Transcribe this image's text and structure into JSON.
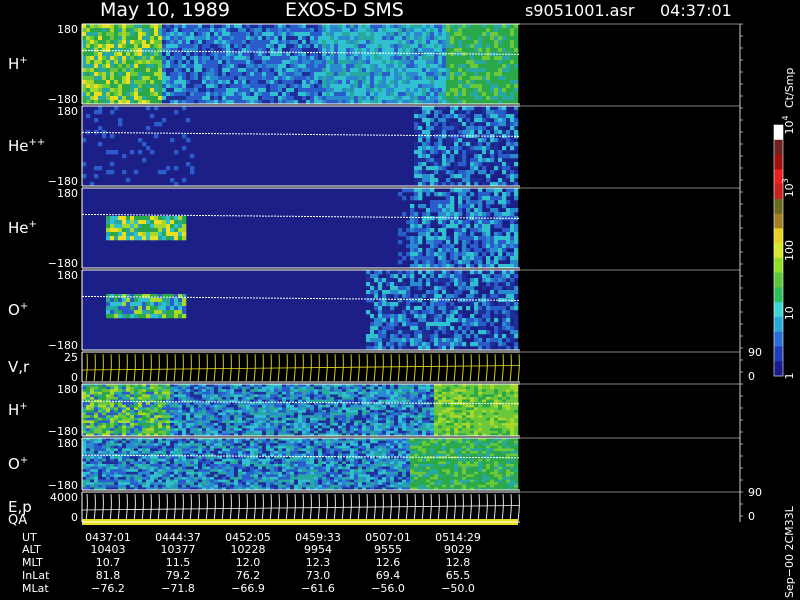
{
  "header": {
    "date": "May 10, 1989",
    "mission": "EXOS-D SMS",
    "file": "s9051001.asr",
    "time": "04:37:01"
  },
  "colorbar": {
    "unit": "Ct/Smp",
    "ticks": [
      {
        "label": "1",
        "value": 1
      },
      {
        "label": "10",
        "value": 10
      },
      {
        "label": "100",
        "value": 100
      },
      {
        "label": "10^3",
        "value": 1000
      },
      {
        "label": "10^4",
        "value": 10000
      }
    ],
    "colors": [
      "#1a1a8c",
      "#1f3fb8",
      "#2a6fd8",
      "#2aa8d8",
      "#3fd6d6",
      "#2fbf5a",
      "#5ac83a",
      "#8ede2a",
      "#d8e82a",
      "#e8d020",
      "#a08020",
      "#6a6a20",
      "#c82020",
      "#e82020",
      "#a01010",
      "#702020",
      "#ffffff"
    ]
  },
  "panels": [
    {
      "label": "H",
      "sup": "+",
      "ytop": "180",
      "ybot": "−180",
      "kind": "spec_h"
    },
    {
      "label": "He",
      "sup": "++",
      "ytop": "180",
      "ybot": "−180",
      "kind": "spec_hepp"
    },
    {
      "label": "He",
      "sup": "+",
      "ytop": "180",
      "ybot": "−180",
      "kind": "spec_hep"
    },
    {
      "label": "O",
      "sup": "+",
      "ytop": "180",
      "ybot": "−180",
      "kind": "spec_op"
    },
    {
      "label": "V,r",
      "sup": "",
      "ytop": "25",
      "ybot": "0",
      "rtop": "90",
      "rbot": "0",
      "kind": "line_y"
    },
    {
      "label": "H",
      "sup": "+",
      "ytop": "180",
      "ybot": "−180",
      "kind": "spec_h2"
    },
    {
      "label": "O",
      "sup": "+",
      "ytop": "180",
      "ybot": "−180",
      "kind": "spec_o2"
    },
    {
      "label": "E,p",
      "sup": "",
      "ytop": "4000",
      "ybot": "0",
      "rtop": "90",
      "rbot": "0",
      "kind": "line_w"
    }
  ],
  "qa_label": "QA",
  "footer_side": "Sep−00  2CM33L",
  "chart_data": {
    "type": "heatmap",
    "title": "May 10, 1989 EXOS-D SMS",
    "x_tick_labels": [
      "0437:01",
      "0444:37",
      "0452:05",
      "0459:33",
      "0507:01",
      "0514:29"
    ],
    "rows": [
      {
        "name": "UT",
        "values": [
          "0437:01",
          "0444:37",
          "0452:05",
          "0459:33",
          "0507:01",
          "0514:29"
        ]
      },
      {
        "name": "ALT",
        "values": [
          "10403",
          "10377",
          "10228",
          "9954",
          "9555",
          "9029"
        ]
      },
      {
        "name": "MLT",
        "values": [
          "10.7",
          "11.5",
          "12.0",
          "12.3",
          "12.6",
          "12.8"
        ]
      },
      {
        "name": "InLat",
        "values": [
          "81.8",
          "79.2",
          "76.2",
          "73.0",
          "69.4",
          "65.5"
        ]
      },
      {
        "name": "MLat",
        "values": [
          "−76.2",
          "−71.8",
          "−66.9",
          "−61.6",
          "−56.0",
          "−50.0"
        ]
      }
    ],
    "panel_y_range": [
      -180,
      180
    ],
    "color_scale": "log",
    "color_range": [
      1,
      10000
    ]
  }
}
